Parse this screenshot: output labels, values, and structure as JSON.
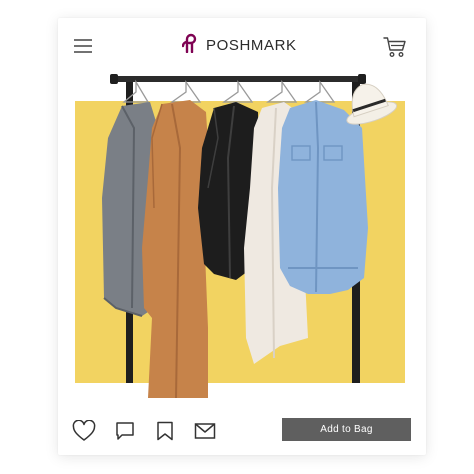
{
  "header": {
    "brand": "POSHMARK",
    "brand_color": "#7f0353",
    "menu_icon": "hamburger-menu-icon",
    "cart_icon": "shopping-cart-icon"
  },
  "listing": {
    "photo_background": "#f2d361",
    "photo_subject": "clothing-rack-with-jackets-and-hat"
  },
  "actions": {
    "icons": [
      "heart-icon",
      "comment-icon",
      "bookmark-icon",
      "share-envelope-icon"
    ],
    "add_to_bag_label": "Add to Bag",
    "button_color": "#5f5f5f"
  }
}
